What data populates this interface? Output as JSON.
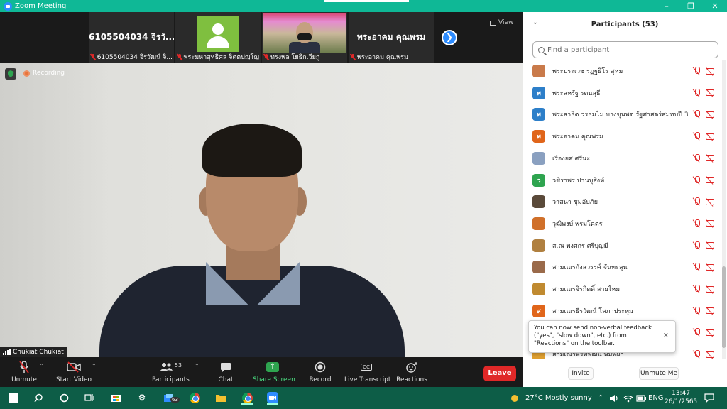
{
  "window": {
    "title": "Zoom Meeting",
    "controls": [
      "–",
      "❐",
      "✕"
    ]
  },
  "thumbnails": [
    {
      "big_name": "6105504034 จิรวั...",
      "caption": "6105504034 จิรวัฒน์ จิ..."
    },
    {
      "big_name": "",
      "caption": "พระมหาสุทธิศล จิตตปญโญ"
    },
    {
      "big_name": "",
      "caption": "ทรงพล โยธิกเวียกู"
    },
    {
      "big_name": "พระอาคม คุณพรม",
      "caption": "พระอาคม คุณพรม"
    }
  ],
  "view_label": "View",
  "main_video": {
    "recording_label": "Recording",
    "speaker_name": "Chukiat Chukiat"
  },
  "toolbar": {
    "unmute": "Unmute",
    "start_video": "Start Video",
    "participants": "Participants",
    "participants_count": "53",
    "chat": "Chat",
    "share_screen": "Share Screen",
    "record": "Record",
    "live_transcript": "Live Transcript",
    "reactions": "Reactions",
    "leave": "Leave",
    "cc_icon_text": "CC"
  },
  "panel": {
    "title": "Participants (53)",
    "search_placeholder": "Find a participant",
    "participants": [
      {
        "name": "พระประเวช รฏฐธิโร สุหม",
        "initial": "",
        "color": "#c97a4a"
      },
      {
        "name": "พระสหรัฐ รตนสุธี",
        "initial": "พ",
        "color": "#2d7fc9"
      },
      {
        "name": "พระสาธิต วรธมโม บางขุนพด  รัฐศาสตร์สมทบปี 3",
        "initial": "พ",
        "color": "#2d7fc9"
      },
      {
        "name": "พระอาคม คุณพรม",
        "initial": "พ",
        "color": "#e0651a"
      },
      {
        "name": "เรืองยศ ศรีนะ",
        "initial": "",
        "color": "#8aa0c0"
      },
      {
        "name": "วชิราพร  ปานบุสิงห์",
        "initial": "ว",
        "color": "#2ea44f"
      },
      {
        "name": "วาสนา ชุมอับภัย",
        "initial": "",
        "color": "#5a4a3a"
      },
      {
        "name": "วุฒิพงษ์ พรมโคตร",
        "initial": "",
        "color": "#d0702a"
      },
      {
        "name": "ส.ณ พงศกร ศรีบุญมี",
        "initial": "",
        "color": "#b08040"
      },
      {
        "name": "สามเณรกังสวรรค์ จันทะลุน",
        "initial": "",
        "color": "#9a6a4a"
      },
      {
        "name": "สามเณรจิรกิตติ์ สายไหม",
        "initial": "",
        "color": "#c08a30"
      },
      {
        "name": "สามเณรธีรวัฒน์ โสภาประทุม",
        "initial": "ส",
        "color": "#e0651a"
      },
      {
        "name": "",
        "initial": "",
        "color": "#2d7fc9"
      },
      {
        "name": "สามเณรพรพิพัฒน์ พิมพ์ผา",
        "initial": "",
        "color": "#e0a030"
      }
    ],
    "tooltip": "You can now send non-verbal feedback (\"yes\", \"slow down\", etc.) from \"Reactions\" on the toolbar.",
    "tooltip_close": "×",
    "invite": "Invite",
    "unmute_me": "Unmute Me"
  },
  "taskbar": {
    "badge": "63",
    "weather": "27°C  Mostly sunny",
    "lang": "ENG",
    "time": "13:47",
    "date": "26/1/2565"
  }
}
